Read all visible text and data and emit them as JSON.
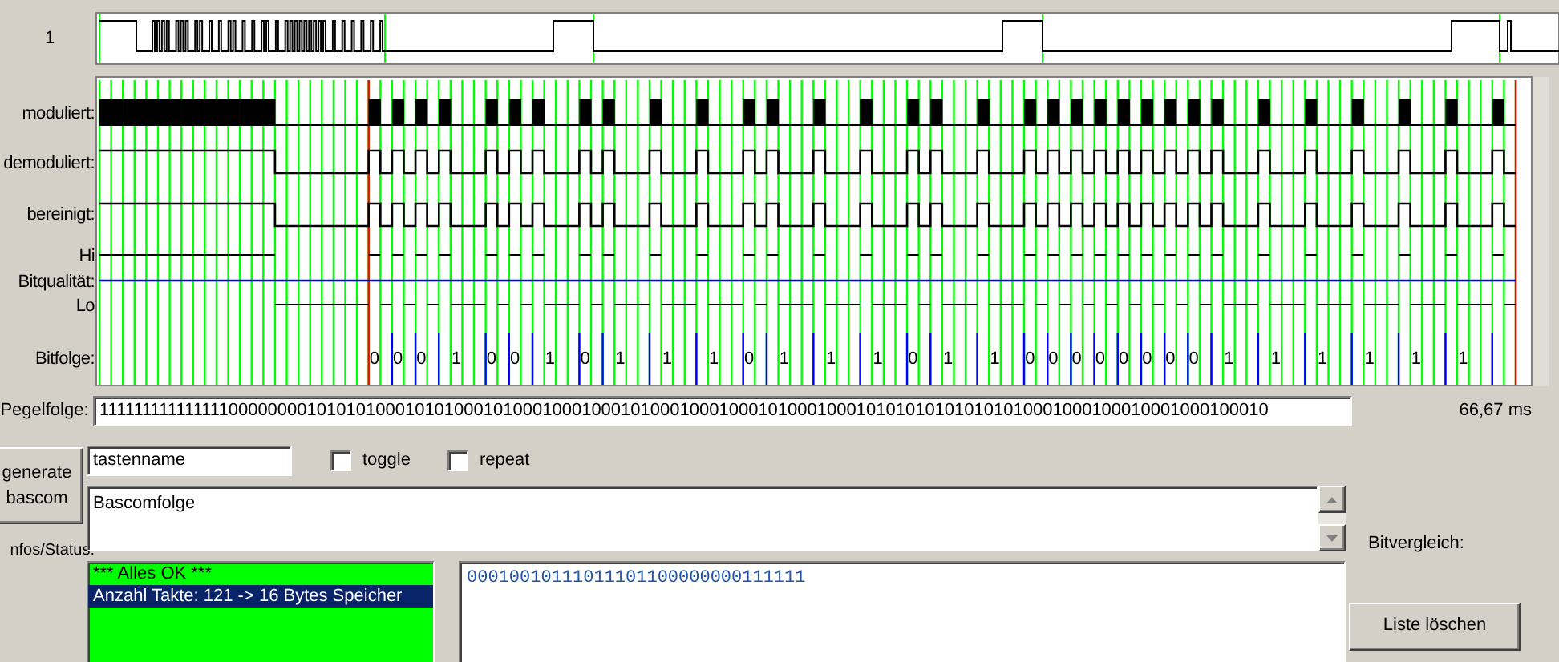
{
  "overview": {
    "channel_label": "1"
  },
  "plot": {
    "row_labels": [
      "moduliert:",
      "demoduliert:",
      "bereinigt:",
      "Hi",
      "Bitqualität:",
      "Lo",
      "Bitfolge:"
    ],
    "bits": [
      "0",
      "0",
      "0",
      "1",
      "0",
      "0",
      "1",
      "0",
      "1",
      "1",
      "1",
      "0",
      "1",
      "1",
      "1",
      "0",
      "1",
      "1",
      "0",
      "0",
      "0",
      "0",
      "0",
      "0",
      "0",
      "0",
      "1",
      "1",
      "1",
      "1",
      "1",
      "1"
    ]
  },
  "pegelfolge": {
    "label": "Pegelfolge:",
    "value": "1111111111111110000000010101010001010100010100010001000101000100010001010001000101010101010101010001000100010001000100010",
    "duration": "66,67 ms"
  },
  "generate_button": {
    "label": "generate bascom"
  },
  "key_name": {
    "value": "tastenname"
  },
  "options": [
    {
      "label": "toggle",
      "checked": false
    },
    {
      "label": "repeat",
      "checked": false
    }
  ],
  "bascom": {
    "value": "Bascomfolge"
  },
  "status": {
    "label": "nfos/Status:",
    "items": [
      {
        "text": "*** Alles OK ***",
        "selected": false
      },
      {
        "text": "Anzahl Takte: 121  -> 16 Bytes Speicher",
        "selected": true
      }
    ]
  },
  "bits_output": {
    "value": "00010010111011101100000000111111"
  },
  "bitvergleich": {
    "label": "Bitvergleich:"
  },
  "clear_button": {
    "label": "Liste löschen"
  }
}
